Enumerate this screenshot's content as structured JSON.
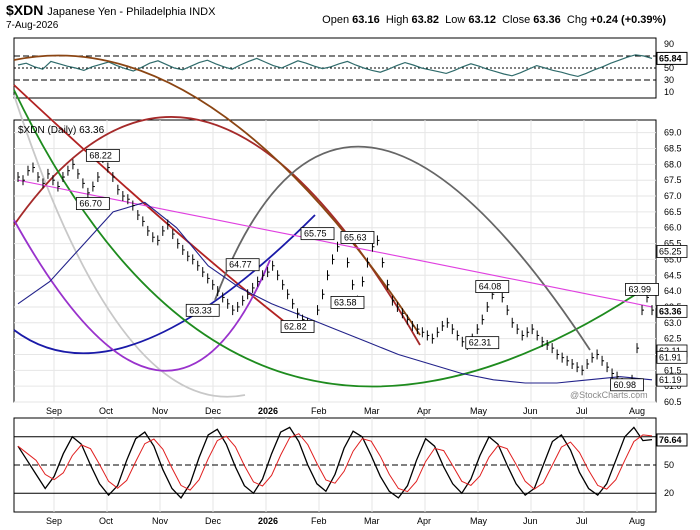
{
  "header": {
    "symbol": "$XDN",
    "description": "Japanese Yen - Philadelphia INDX",
    "date": "7-Aug-2026",
    "open_label": "Open",
    "open": "63.16",
    "high_label": "High",
    "high": "63.82",
    "low_label": "Low",
    "low": "63.12",
    "close_label": "Close",
    "close": "63.36",
    "chg_label": "Chg",
    "chg": "+0.24 (+0.39%)"
  },
  "watermark": "@StockCharts.com",
  "chart_data": [
    {
      "type": "line",
      "panel": "rsi",
      "y_ticks": [
        10,
        30,
        50,
        70,
        90
      ],
      "ylim": [
        0,
        100
      ],
      "last_value_label": "65.84",
      "reference_lines": [
        30,
        50,
        70
      ],
      "series": [
        {
          "values": [
            55,
            58,
            52,
            48,
            61,
            57,
            53,
            50,
            46,
            52,
            56,
            60,
            54,
            49,
            45,
            51,
            58,
            62,
            56,
            50,
            47,
            53,
            59,
            63,
            57,
            52,
            48,
            55,
            61,
            66,
            60,
            54,
            50,
            56,
            62,
            58,
            53,
            49,
            52,
            57,
            61,
            55,
            50,
            46,
            43,
            48,
            54,
            59,
            55,
            50,
            47,
            44,
            41,
            46,
            52,
            57,
            53,
            48,
            44,
            40,
            37,
            42,
            48,
            54,
            50,
            46,
            43,
            39,
            36,
            41,
            47,
            52,
            58,
            63,
            68,
            72,
            70,
            66
          ]
        }
      ]
    },
    {
      "type": "line",
      "panel": "price",
      "legend": "$XDN (Daily) 63.36",
      "y_ticks": [
        60.5,
        61.0,
        61.5,
        62.0,
        62.5,
        63.0,
        63.5,
        64.0,
        64.5,
        65.0,
        65.5,
        66.0,
        66.5,
        67.0,
        67.5,
        68.0,
        68.5,
        69.0
      ],
      "ylim": [
        60.5,
        69.4
      ],
      "x_labels": [
        "Sep",
        "Oct",
        "Nov",
        "Dec",
        "2026",
        "Feb",
        "Mar",
        "Apr",
        "May",
        "Jun",
        "Jul",
        "Aug"
      ],
      "right_labels": [
        "65.25",
        "63.36",
        "62.11",
        "61.91",
        "61.19"
      ],
      "annotations": [
        {
          "text": "68.22",
          "x": 17,
          "y": 68.22
        },
        {
          "text": "66.70",
          "x": 15,
          "y": 66.7
        },
        {
          "text": "65.75",
          "x": 60,
          "y": 65.75
        },
        {
          "text": "65.63",
          "x": 68,
          "y": 65.63
        },
        {
          "text": "64.77",
          "x": 45,
          "y": 64.77
        },
        {
          "text": "63.33",
          "x": 37,
          "y": 63.33
        },
        {
          "text": "63.58",
          "x": 66,
          "y": 63.58
        },
        {
          "text": "62.82",
          "x": 56,
          "y": 62.82
        },
        {
          "text": "64.08",
          "x": 95,
          "y": 64.08
        },
        {
          "text": "62.31",
          "x": 93,
          "y": 62.31
        },
        {
          "text": "63.99",
          "x": 125,
          "y": 63.99
        },
        {
          "text": "60.98",
          "x": 122,
          "y": 60.98
        }
      ],
      "series": [
        {
          "name": "price",
          "values": [
            67.6,
            67.5,
            67.8,
            67.9,
            67.6,
            67.4,
            67.7,
            67.5,
            67.3,
            67.6,
            67.8,
            68.0,
            67.7,
            67.4,
            67.1,
            67.3,
            67.6,
            68.2,
            67.9,
            67.6,
            67.2,
            67.0,
            66.9,
            66.7,
            66.4,
            66.2,
            65.9,
            65.7,
            65.6,
            65.9,
            66.1,
            65.8,
            65.5,
            65.3,
            65.1,
            65.0,
            64.8,
            64.6,
            64.4,
            64.2,
            64.0,
            63.8,
            63.6,
            63.4,
            63.5,
            63.7,
            63.9,
            64.1,
            64.3,
            64.5,
            64.6,
            64.8,
            64.5,
            64.2,
            63.9,
            63.6,
            63.3,
            63.1,
            63.0,
            62.9,
            63.4,
            63.9,
            64.5,
            65.0,
            65.4,
            65.7,
            64.9,
            64.2,
            63.7,
            64.3,
            64.9,
            65.4,
            65.6,
            64.9,
            64.2,
            63.7,
            63.5,
            63.3,
            63.1,
            62.9,
            62.8,
            62.7,
            62.6,
            62.5,
            62.7,
            62.9,
            63.0,
            62.8,
            62.6,
            62.4,
            62.3,
            62.5,
            62.8,
            63.1,
            63.5,
            63.9,
            64.1,
            63.8,
            63.4,
            63.0,
            62.8,
            62.6,
            62.7,
            62.8,
            62.6,
            62.4,
            62.3,
            62.2,
            62.0,
            61.9,
            61.8,
            61.7,
            61.6,
            61.5,
            61.7,
            61.9,
            62.0,
            61.8,
            61.6,
            61.4,
            61.3,
            61.1,
            61.0,
            61.2,
            62.2,
            63.4,
            63.8,
            63.4
          ]
        },
        {
          "name": "ma-pink",
          "values": [
            67.5,
            67.3,
            67.1,
            66.9,
            66.7,
            66.5,
            66.3,
            66.1,
            65.9,
            65.7,
            65.5,
            65.3,
            65.1,
            64.9,
            64.7,
            64.5,
            64.3,
            64.1,
            63.9,
            63.7,
            63.5
          ]
        },
        {
          "name": "ma-blue",
          "values": [
            63.6,
            64.3,
            65.4,
            66.5,
            66.8,
            66.0,
            64.8,
            64.1,
            63.6,
            63.2,
            62.8,
            62.4,
            62.0,
            61.7,
            61.4,
            61.2,
            61.1,
            61.1,
            61.2,
            61.3,
            61.2
          ]
        }
      ]
    },
    {
      "type": "line",
      "panel": "stochastic",
      "y_ticks": [
        20,
        50,
        80
      ],
      "ylim": [
        0,
        100
      ],
      "last_value_label": "76.64",
      "reference_lines": [
        20,
        50,
        80
      ],
      "series": [
        {
          "name": "%K",
          "values": [
            70,
            55,
            40,
            25,
            38,
            62,
            80,
            72,
            50,
            30,
            18,
            28,
            55,
            78,
            85,
            70,
            45,
            25,
            15,
            30,
            58,
            82,
            88,
            72,
            48,
            28,
            20,
            35,
            62,
            85,
            90,
            75,
            50,
            30,
            22,
            40,
            68,
            86,
            80,
            60,
            38,
            22,
            15,
            28,
            55,
            78,
            70,
            48,
            30,
            20,
            35,
            60,
            80,
            72,
            50,
            30,
            18,
            25,
            50,
            75,
            82,
            66,
            42,
            25,
            18,
            30,
            55,
            80,
            90,
            76,
            77
          ]
        }
      ]
    }
  ]
}
